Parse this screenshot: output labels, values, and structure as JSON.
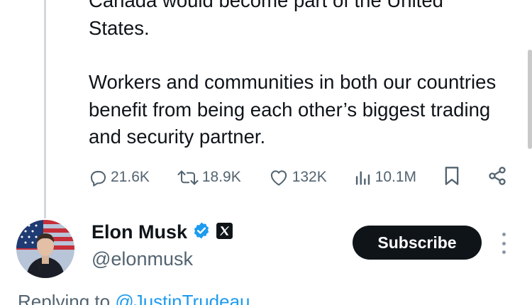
{
  "tweet": {
    "paragraphs": [
      "Canada would become part of the United States.",
      "Workers and communities in both our countries benefit from being each other’s biggest trading and security partner."
    ]
  },
  "actions": {
    "replies": "21.6K",
    "reposts": "18.9K",
    "likes": "132K",
    "views": "10.1M",
    "icons": [
      "reply-icon",
      "repost-icon",
      "heart-icon",
      "views-icon",
      "bookmark-icon",
      "share-icon"
    ]
  },
  "reply": {
    "name": "Elon Musk",
    "handle": "@elonmusk",
    "subscribe_label": "Subscribe",
    "replying_prefix": "Replying to ",
    "replying_to": "@JustinTrudeau",
    "verified_color": "#1d9bf0"
  },
  "colors": {
    "text": "#0f1419",
    "muted": "#536471",
    "accent": "#1d9bf0"
  }
}
